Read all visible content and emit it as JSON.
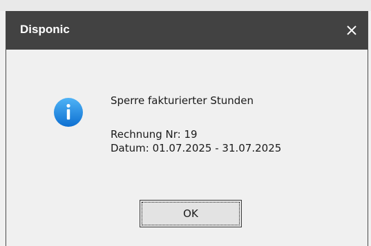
{
  "dialog": {
    "title": "Disponic",
    "close_icon": "close-icon",
    "message_icon": "info-icon",
    "message_title": "Sperre fakturierter Stunden",
    "message_lines": [
      "Rechnung Nr: 19",
      "Datum: 01.07.2025 - 31.07.2025"
    ],
    "ok_label": "OK"
  },
  "colors": {
    "titlebar": "#424242",
    "title_text": "#ffffff",
    "body_background": "#f0f0f0",
    "info_icon_blue": "#1e88e5"
  }
}
